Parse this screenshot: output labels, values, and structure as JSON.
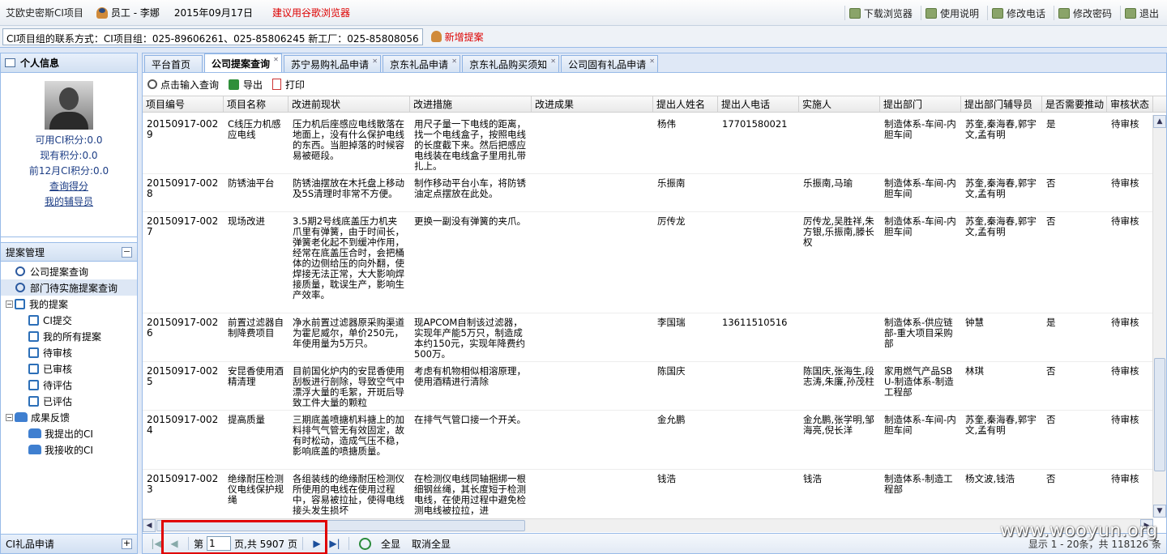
{
  "topbar": {
    "app_title": "艾欧史密斯CI项目",
    "user": "员工 - 李娜",
    "date": "2015年09月17日",
    "warning": "建议用谷歌浏览器"
  },
  "top_actions": [
    "下载浏览器",
    "使用说明",
    "修改电话",
    "修改密码",
    "退出"
  ],
  "contact": {
    "text": "CI项目组的联系方式：CI项目组：025-89606261、025-85806245 新工厂：025-85808056",
    "new_proposal": "新增提案"
  },
  "sidebar": {
    "personal_title": "个人信息",
    "points": [
      "可用CI积分:0.0",
      "现有积分:0.0",
      "前12月CI积分:0.0"
    ],
    "links": [
      "查询得分",
      "我的辅导员"
    ],
    "section_title": "提案管理",
    "tree": [
      {
        "label": "公司提案查询",
        "icon": "magnifier-icon",
        "level": 1
      },
      {
        "label": "部门待实施提案查询",
        "icon": "magnifier-icon",
        "level": 1,
        "selected": true
      },
      {
        "label": "我的提案",
        "icon": "edit-icon",
        "level": 0,
        "expander": "−"
      },
      {
        "label": "CI提交",
        "icon": "edit-icon",
        "level": 2
      },
      {
        "label": "我的所有提案",
        "icon": "edit-icon",
        "level": 2
      },
      {
        "label": "待审核",
        "icon": "edit-icon",
        "level": 2
      },
      {
        "label": "已审核",
        "icon": "edit-icon",
        "level": 2
      },
      {
        "label": "待评估",
        "icon": "edit-icon",
        "level": 2
      },
      {
        "label": "已评估",
        "icon": "edit-icon",
        "level": 2
      },
      {
        "label": "成果反馈",
        "icon": "people-icon",
        "level": 0,
        "expander": "−"
      },
      {
        "label": "我提出的CI",
        "icon": "people-icon",
        "level": 2
      },
      {
        "label": "我接收的CI",
        "icon": "people-icon",
        "level": 2
      }
    ],
    "bottom_title": "CI礼品申请"
  },
  "tabs": [
    "平台首页",
    "公司提案查询",
    "苏宁易购礼品申请",
    "京东礼品申请",
    "京东礼品购买须知",
    "公司固有礼品申请"
  ],
  "toolbar": [
    "点击输入查询",
    "导出",
    "打印"
  ],
  "columns": [
    "项目编号",
    "项目名称",
    "改进前现状",
    "改进措施",
    "改进成果",
    "提出人姓名",
    "提出人电话",
    "实施人",
    "提出部门",
    "提出部门辅导员",
    "是否需要推动",
    "审核状态"
  ],
  "rows": [
    [
      "20150917-0029",
      "C线压力机感应电线",
      "压力机后座感应电线散落在地面上，没有什么保护电线的东西。当胆掉落的时候容易被砸段。",
      "用尺子量一下电线的距离，找一个电线盒子，按照电线的长度截下来。然后把感应电线装在电线盒子里用扎带扎上。",
      "",
      "杨伟",
      "17701580021",
      "",
      "制造体系-车间-内胆车间",
      "苏奎,秦海春,郭宇文,孟有明",
      "是",
      "待审核"
    ],
    [
      "20150917-0028",
      "防锈油平台",
      "防锈油摆放在木托盘上移动及5S清理时非常不方便。",
      "制作移动平台小车，将防锈油定点摆放在此处。",
      "",
      "乐振南",
      "",
      "乐振南,马瑜",
      "制造体系-车间-内胆车间",
      "苏奎,秦海春,郭宇文,孟有明",
      "否",
      "待审核"
    ],
    [
      "20150917-0027",
      "现场改进",
      "3.5期2号线底盖压力机夹爪里有弹簧，由于时间长，弹簧老化起不到缓冲作用，经常在底盖压合时，会把桶体的边侧给压的向外翻，使焊接无法正常，大大影响焊接质量，耽误生产，影响生产效率。",
      "更换一副没有弹簧的夹爪。",
      "",
      "厉传龙",
      "",
      "厉传龙,吴胜祥,朱方银,乐振南,滕长权",
      "制造体系-车间-内胆车间",
      "苏奎,秦海春,郭宇文,孟有明",
      "否",
      "待审核"
    ],
    [
      "20150917-0026",
      "前置过滤器自制降费项目",
      "净水前置过滤器原采购渠道为霍尼威尔，单价250元，年使用量为5万只。",
      "现APCOM自制该过滤器，实现年产能5万只，制造成本约150元，实现年降费约500万。",
      "",
      "李国瑞",
      "13611510516",
      "",
      "制造体系-供应链部-重大项目采购部",
      "钟慧",
      "是",
      "待审核"
    ],
    [
      "20150917-0025",
      "安昆香使用酒精清理",
      "目前国化炉内的安昆香使用刮板进行剖除，导致空气中漂浮大量的毛絮，开斑后导致工件大量的颗粒",
      "考虑有机物相似相溶原理，使用酒精进行清除",
      "",
      "陈国庆",
      "",
      "陈国庆,张海生,段志涛,朱廉,孙茂柱",
      "家用燃气产品SBU-制造体系-制造工程部",
      "林琪",
      "否",
      "待审核"
    ],
    [
      "20150917-0024",
      "提高质量",
      "三期底盖喷搪机料搪上的加料排气气管无有效固定，故有时松动，造成气压不稳，影响底盖的喷搪质量。",
      "在排气气管口接一个开关。",
      "",
      "金允鹏",
      "",
      "金允鹏,张学明,邹海亮,倪长洋",
      "制造体系-车间-内胆车间",
      "苏奎,秦海春,郭宇文,孟有明",
      "否",
      "待审核"
    ],
    [
      "20150917-0023",
      "绝缘耐压检测仪电线保护规绳",
      "各组装线的绝缘耐压检测仪所使用的电线在使用过程中，容易被拉扯，使得电线接头发生损坏",
      "在检测仪电线同轴捆绑一根细钢丝绳，其长度短于检测电线，在使用过程中避免检测电线被拉拉，进",
      "",
      "钱浩",
      "",
      "钱浩",
      "制造体系-制造工程部",
      "杨文波,钱浩",
      "否",
      "待审核"
    ]
  ],
  "pager": {
    "page_prefix": "第",
    "page_value": "1",
    "page_suffix": "页,共 5907 页",
    "show_all": "全显",
    "cancel_all": "取消全显",
    "info": "显示 1 - 20条，共 118126 条"
  },
  "watermark": "www.wooyun.org"
}
